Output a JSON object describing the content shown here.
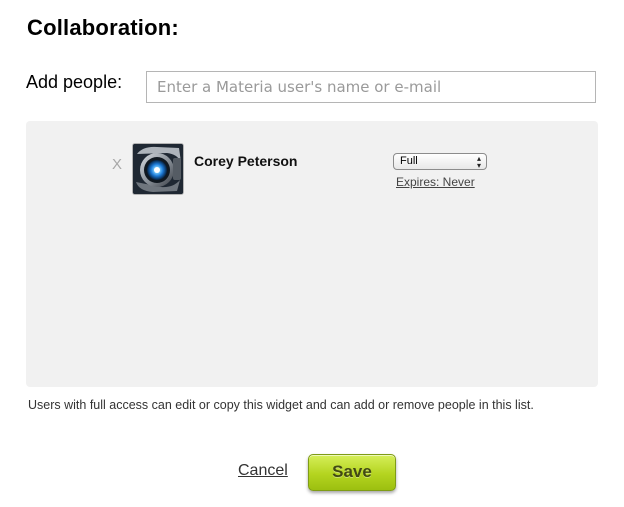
{
  "dialog": {
    "title": "Collaboration:"
  },
  "add_people": {
    "label": "Add people:",
    "input_value": "",
    "placeholder": "Enter a Materia user's name or e-mail"
  },
  "collaborators": [
    {
      "remove_label": "X",
      "avatar_icon": "robot-eye-avatar",
      "name": "Corey Peterson",
      "access_level": "Full",
      "expires_label": "Expires: Never"
    }
  ],
  "help_text": "Users with full access can edit or copy this widget and can add or remove people in this list.",
  "actions": {
    "cancel_label": "Cancel",
    "save_label": "Save"
  },
  "colors": {
    "panel_background": "#f1f1f1",
    "save_button": "#b4d41f"
  }
}
